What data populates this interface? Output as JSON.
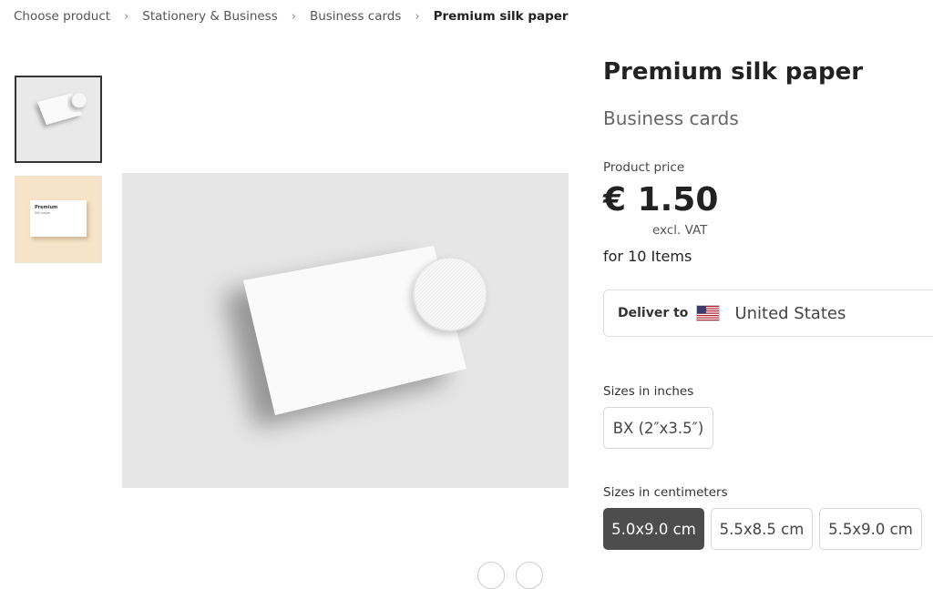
{
  "breadcrumb": {
    "items": [
      "Choose product",
      "Stationery & Business",
      "Business cards"
    ],
    "current": "Premium silk paper",
    "separator": ">"
  },
  "gallery": {
    "thumbnails": [
      {
        "name": "card-mockup-gray",
        "selected": true
      },
      {
        "name": "card-mockup-peach",
        "selected": false,
        "card_title": "Premium",
        "card_subtitle": "Silk paper"
      }
    ]
  },
  "product": {
    "title": "Premium silk paper",
    "category": "Business cards",
    "price_label": "Product price",
    "price": "€ 1.50",
    "vat_note": "excl. VAT",
    "quantity_note": "for 10 Items"
  },
  "delivery": {
    "label": "Deliver to",
    "country": "United States",
    "flag_icon": "us-flag-icon"
  },
  "sizes_inches": {
    "label": "Sizes in inches",
    "options": [
      "BX (2″x3.5″)"
    ]
  },
  "sizes_cm": {
    "label": "Sizes in centimeters",
    "options": [
      "5.0x9.0 cm",
      "5.5x8.5 cm",
      "5.5x9.0 cm"
    ],
    "selected": "5.0x9.0 cm"
  },
  "colors": {
    "selected_size_bg": "#4d4d4d",
    "image_bg": "#e6e6e6",
    "thumb_peach": "#f7e3c8"
  }
}
